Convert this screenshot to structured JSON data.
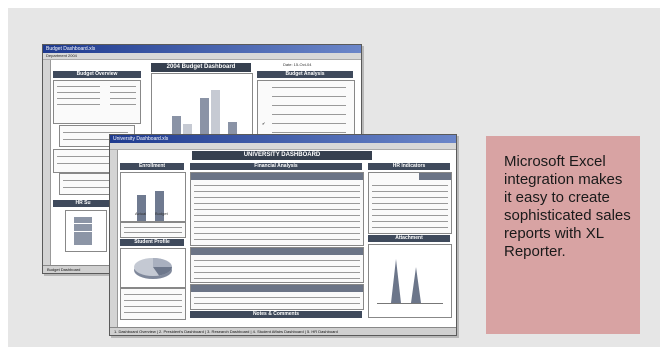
{
  "caption": {
    "text": "Microsoft Excel integration makes it easy to create sophisticated sales reports with XL Reporter."
  },
  "window1": {
    "title": "Budget Dashboard.xls",
    "toolbar": "Department  2004",
    "dashboard_title": "2004 Budget Dashboard",
    "budget_overview": "Budget Overview",
    "budget_analysis": "Budget Analysis",
    "sheet_tabs": "Budget Dashboard",
    "date_label": "Date: 15-Oct-04",
    "hr_label": "HR Su"
  },
  "window2": {
    "title": "University Dashboard.xls",
    "dashboard_title": "UNIVERSITY DASHBOARD",
    "enrollment": "Enrollment",
    "financial_analysis": "Financial Analysis",
    "hr_indicators": "HR Indicators",
    "student_profile": "Student Profile",
    "attachment": "Attachment",
    "notes": "Notes & Comments",
    "legend_actual": "Actual",
    "legend_budget": "Budget",
    "sheet_tabs": "1. Dashboard Overview | 2. President's Dashboard | 3. Research Dashboard | 4. Student Affairs Dashboard | 5. HR Dashboard"
  },
  "colors": {
    "background": "#e6e6e6",
    "caption_bg": "#d8a3a3",
    "header_dark": "#3f4a5c"
  }
}
